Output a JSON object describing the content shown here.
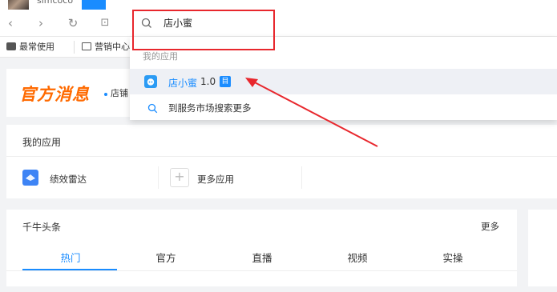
{
  "topbar": {
    "username": "simcoco"
  },
  "nav": {
    "back": "‹",
    "forward": "›",
    "refresh": "↻",
    "image": "⊡"
  },
  "search": {
    "value": "店小蜜",
    "icon": "search-icon"
  },
  "bookmarks": [
    {
      "label": "最常使用",
      "icon": "briefcase-icon"
    },
    {
      "label": "营销中心",
      "icon": "folder-icon"
    }
  ],
  "dropdown": {
    "section_label": "我的应用",
    "app_name": "店小蜜",
    "app_version": "1.0",
    "app_badge": "目",
    "search_more": "到服务市场搜索更多"
  },
  "news": {
    "title": "官方消息",
    "subtitle": "店铺"
  },
  "myapps": {
    "title": "我的应用",
    "items": [
      {
        "label": "绩效雷达",
        "icon": "radar-icon"
      },
      {
        "label": "更多应用",
        "icon": "plus-icon"
      }
    ]
  },
  "headlines": {
    "title": "千牛头条",
    "more": "更多",
    "tabs": [
      "热门",
      "官方",
      "直播",
      "视频",
      "实操"
    ]
  },
  "colors": {
    "accent": "#1a8cff",
    "brand_orange": "#ff6a00",
    "annotation_red": "#e8272d"
  }
}
